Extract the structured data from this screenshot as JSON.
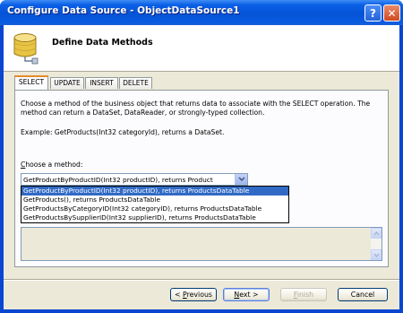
{
  "window": {
    "title": "Configure Data Source - ObjectDataSource1",
    "help_button": "?",
    "close_button": "✕"
  },
  "header": {
    "title": "Define Data Methods",
    "icon": "database-icon"
  },
  "tabs": [
    {
      "label": "SELECT",
      "active": true
    },
    {
      "label": "UPDATE",
      "active": false
    },
    {
      "label": "INSERT",
      "active": false
    },
    {
      "label": "DELETE",
      "active": false
    }
  ],
  "panel": {
    "description": "Choose a method of the business object that returns data to associate with the SELECT operation. The method can return a DataSet, DataReader, or strongly-typed collection.",
    "example": "Example: GetProducts(Int32 categoryId), returns a DataSet.",
    "choose_label_prefix": "C",
    "choose_label_rest": "hoose a method:",
    "combo_value": "GetProductByProductID(Int32 productID), returns Product",
    "dropdown_options": [
      "GetProductByProductID(Int32 productID), returns ProductsDataTable",
      "GetProducts(), returns ProductsDataTable",
      "GetProductsByCategoryID(Int32 categoryID), returns ProductsDataTable",
      "GetProductsBySupplierID(Int32 supplierID), returns ProductsDataTable"
    ],
    "selected_option_index": 0
  },
  "buttons": {
    "previous_prefix": "< ",
    "previous_u": "P",
    "previous_rest": "revious",
    "next_u": "N",
    "next_rest": "ext >",
    "finish_u": "F",
    "finish_rest": "inish",
    "cancel": "Cancel"
  },
  "colors": {
    "titlebar": "#0553d6",
    "selection": "#316ac5",
    "active_tab_accent": "#e68b2c"
  }
}
